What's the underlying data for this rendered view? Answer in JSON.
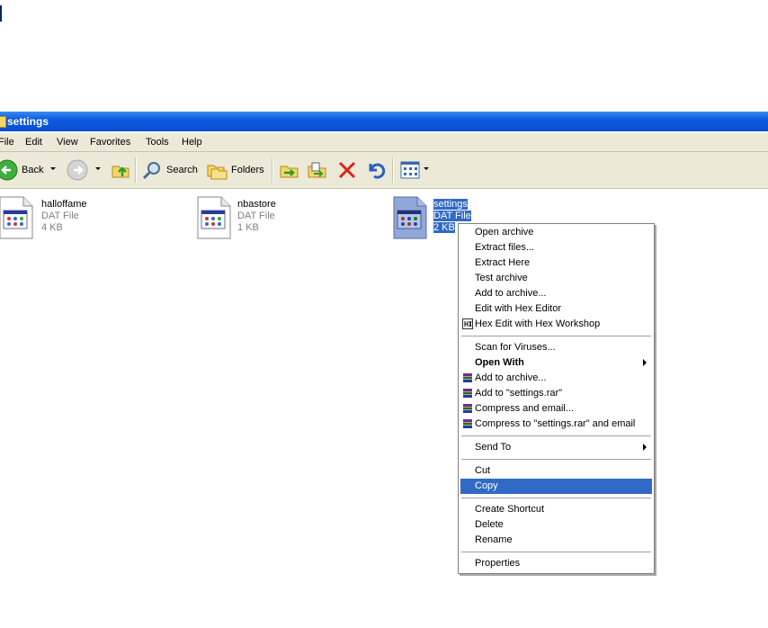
{
  "window": {
    "title": "settings"
  },
  "menu": [
    "File",
    "Edit",
    "View",
    "Favorites",
    "Tools",
    "Help"
  ],
  "toolbar": {
    "back_label": "Back",
    "search_label": "Search",
    "folders_label": "Folders"
  },
  "files": [
    {
      "name": "halloffame",
      "type": "DAT File",
      "size": "4 KB",
      "icon": "dat-file-icon"
    },
    {
      "name": "nbastore",
      "type": "DAT File",
      "size": "1 KB",
      "icon": "dat-file-icon"
    },
    {
      "name": "settings",
      "type": "DAT File",
      "size": "2 KB",
      "icon": "dat-file-icon",
      "selected": true
    }
  ],
  "context_menu": {
    "items": [
      {
        "label": "Open archive"
      },
      {
        "label": "Extract files..."
      },
      {
        "label": "Extract Here"
      },
      {
        "label": "Test archive"
      },
      {
        "label": "Add to archive..."
      },
      {
        "label": "Edit with Hex Editor"
      },
      {
        "label": "Hex Edit with Hex Workshop",
        "icon": "hex-workshop-icon"
      },
      {
        "label": "Scan for Viruses..."
      },
      {
        "label": "Open With",
        "bold": true,
        "submenu": true
      },
      {
        "label": "Add to archive...",
        "icon": "winrar-icon"
      },
      {
        "label": "Add to \"settings.rar\"",
        "icon": "winrar-icon"
      },
      {
        "label": "Compress and email...",
        "icon": "winrar-icon"
      },
      {
        "label": "Compress to \"settings.rar\" and email",
        "icon": "winrar-icon"
      },
      {
        "label": "Send To",
        "submenu": true
      },
      {
        "label": "Cut"
      },
      {
        "label": "Copy",
        "highlighted": true
      },
      {
        "label": "Create Shortcut"
      },
      {
        "label": "Delete"
      },
      {
        "label": "Rename"
      },
      {
        "label": "Properties"
      }
    ]
  },
  "colors": {
    "selection": "#316ac5",
    "titlebar": "#0a4fd0",
    "chrome": "#ece9d8"
  }
}
